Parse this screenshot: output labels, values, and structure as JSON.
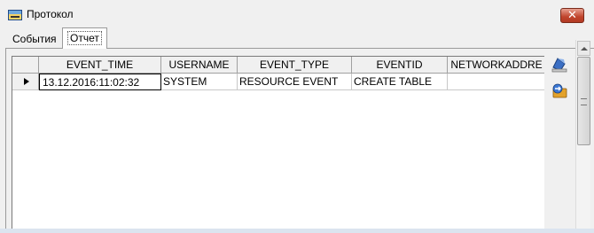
{
  "window": {
    "title": "Протокол",
    "close_label": "✕"
  },
  "tabs": [
    {
      "label": "События",
      "active": false
    },
    {
      "label": "Отчет",
      "active": true
    }
  ],
  "grid": {
    "columns": [
      "EVENT_TIME",
      "USERNAME",
      "EVENT_TYPE",
      "EVENTID",
      "NETWORKADDRE"
    ],
    "rows": [
      {
        "event_time": "13.12.2016:11:02:32",
        "username": "SYSTEM",
        "event_type": "RESOURCE EVENT",
        "eventid": "CREATE TABLE",
        "networkaddress": ""
      }
    ]
  },
  "toolbar": {
    "buttons": [
      {
        "icon": "print-icon"
      },
      {
        "icon": "export-icon"
      }
    ]
  },
  "colors": {
    "close_button": "#c0442c",
    "grid_background": "#ffffff",
    "window_background": "#f0f0f0"
  }
}
